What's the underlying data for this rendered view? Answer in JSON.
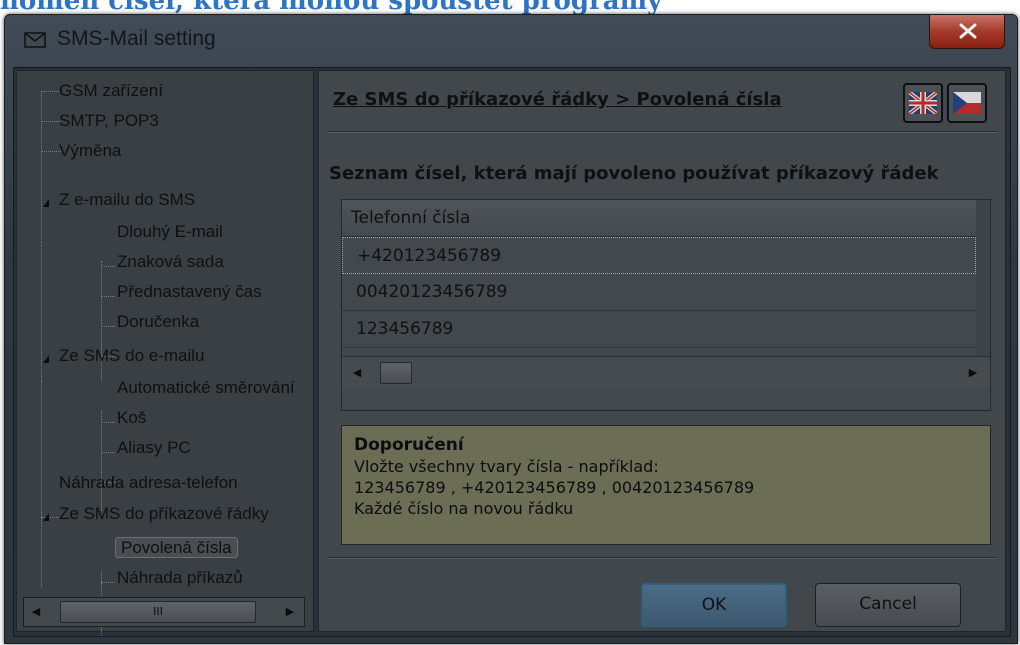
{
  "document": {
    "heading_fragment": "nomen čísel, která mohou spouštět programy"
  },
  "window": {
    "title": "SMS-Mail setting",
    "close_glyph": "X"
  },
  "tree": {
    "items": [
      {
        "label": "GSM zařízení"
      },
      {
        "label": "SMTP, POP3"
      },
      {
        "label": "Výměna"
      },
      {
        "label": "Z e-mailu do SMS"
      },
      {
        "label": "Dlouhý E-mail"
      },
      {
        "label": "Znaková sada"
      },
      {
        "label": "Přednastavený čas"
      },
      {
        "label": "Doručenka"
      },
      {
        "label": "Ze SMS do e-mailu"
      },
      {
        "label": "Automatické směrování"
      },
      {
        "label": "Koš"
      },
      {
        "label": "Aliasy PC"
      },
      {
        "label": "Náhrada adresa-telefon"
      },
      {
        "label": "Ze SMS do příkazové řádky"
      },
      {
        "label": "Povolená čísla"
      },
      {
        "label": "Náhrada příkazů"
      }
    ],
    "selected": "Povolená čísla",
    "scrollbar_thumb_glyph": "III"
  },
  "content": {
    "breadcrumb": "Ze SMS do příkazové řádky  >  Povolená čísla",
    "language_buttons": [
      "english-flag-icon",
      "czech-flag-icon"
    ],
    "list_title": "Seznam čísel, která mají povoleno používat příkazový řádek",
    "grid": {
      "column_header": "Telefonní čísla",
      "rows": [
        "+420123456789",
        "00420123456789",
        "123456789"
      ]
    },
    "tip": {
      "title": "Doporučení",
      "lines": [
        "Vložte všechny tvary čísla - například:",
        "123456789 , +420123456789 , 00420123456789",
        "Každé číslo na novou řádku"
      ]
    },
    "buttons": {
      "ok": "OK",
      "cancel": "Cancel"
    }
  },
  "colors": {
    "window_frame": "#2f3842",
    "close_button": "#a43a2a",
    "tip_background": "#6b6d55",
    "heading_blue": "#2e74c4"
  }
}
